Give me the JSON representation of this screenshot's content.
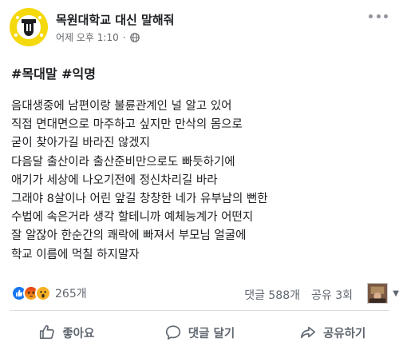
{
  "post": {
    "page_name": "목원대학교 대신 말해줘",
    "timestamp": "어제 오후 1:10",
    "separator": "·",
    "hashtags": "#목대말 #익명",
    "lines": [
      "음대생중에 남편이랑 불륜관계인 널 알고 있어",
      "직접 면대면으로 마주하고 싶지만 만삭의 몸으로",
      "굳이 찾아가길 바라진 않겠지",
      "다음달 출산이라 출산준비만으로도 빠듯하기에",
      "애기가 세상에 나오기전에 정신차리길 바라",
      "그래야 8살이나 어린 앞길 창창한 네가 유부남의 뻔한",
      "수법에 속은거라 생각 할테니까 예체능계가 어떤지",
      "잘 알잖아 한순간의 쾌락에 빠져서 부모님 얼굴에",
      "학교 이름에 먹칠 하지말자"
    ]
  },
  "stats": {
    "reaction_count": "265개",
    "comments": "댓글 588개",
    "shares": "공유 3회"
  },
  "actions": {
    "like": "좋아요",
    "comment": "댓글 달기",
    "share": "공유하기"
  },
  "icons": {
    "avatar": "school-logo-icon",
    "globe": "globe-icon",
    "more": "more-options-icon",
    "reactions": [
      "like-reaction-icon",
      "angry-reaction-icon",
      "wow-reaction-icon"
    ],
    "like": "thumbs-up-icon",
    "comment": "comment-bubble-icon",
    "share": "share-arrow-icon"
  },
  "colors": {
    "avatar_bg": "#f5d90f",
    "like_blue": "#1877f2",
    "angry_red": "#e9710f",
    "wow_yellow": "#f7b125",
    "text_secondary": "#606770"
  }
}
